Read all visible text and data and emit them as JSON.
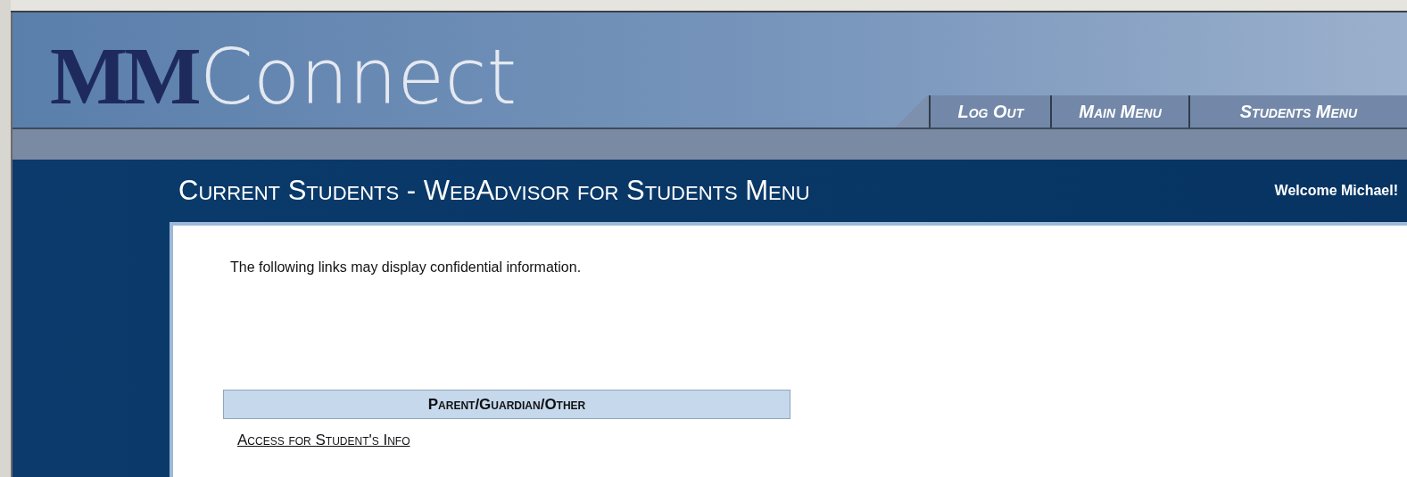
{
  "logo": {
    "initials": "MM",
    "word": "Connect"
  },
  "nav_tabs": [
    {
      "label": "Log Out"
    },
    {
      "label": "Main Menu"
    },
    {
      "label": "Students Menu"
    }
  ],
  "page_title": "Current Students - WebAdvisor for Students Menu",
  "welcome": "Welcome Michael!",
  "notice": "The following links may display confidential information.",
  "sections": [
    {
      "heading": "Parent/Guardian/Other",
      "links": [
        "Access for Student's Info"
      ]
    }
  ]
}
